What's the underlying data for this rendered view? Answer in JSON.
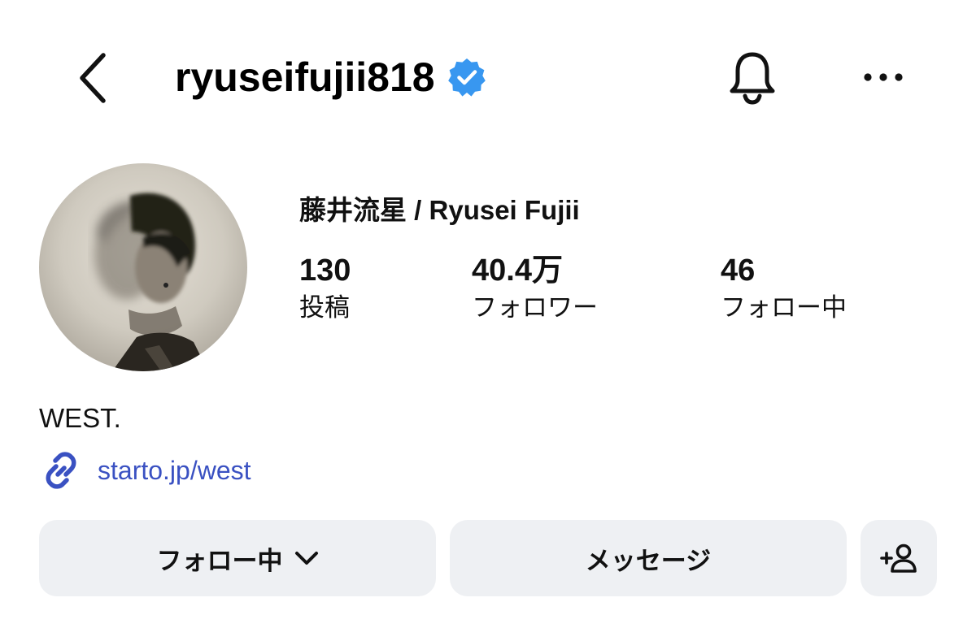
{
  "header": {
    "username": "ryuseifujii818",
    "icons": {
      "back": "chevron-left-icon",
      "verified": "verified-badge-icon",
      "notifications": "bell-icon",
      "more": "more-horizontal-icon"
    }
  },
  "profile": {
    "display_name": "藤井流星 / Ryusei Fujii",
    "stats": [
      {
        "value": "130",
        "label": "投稿"
      },
      {
        "value": "40.4万",
        "label": "フォロワー"
      },
      {
        "value": "46",
        "label": "フォロー中"
      }
    ],
    "bio": "WEST.",
    "link": "starto.jp/west"
  },
  "actions": {
    "following_label": "フォロー中",
    "message_label": "メッセージ"
  },
  "colors": {
    "verified_blue": "#3897f0",
    "link_blue": "#3a51c2",
    "button_bg": "#eef0f3"
  }
}
